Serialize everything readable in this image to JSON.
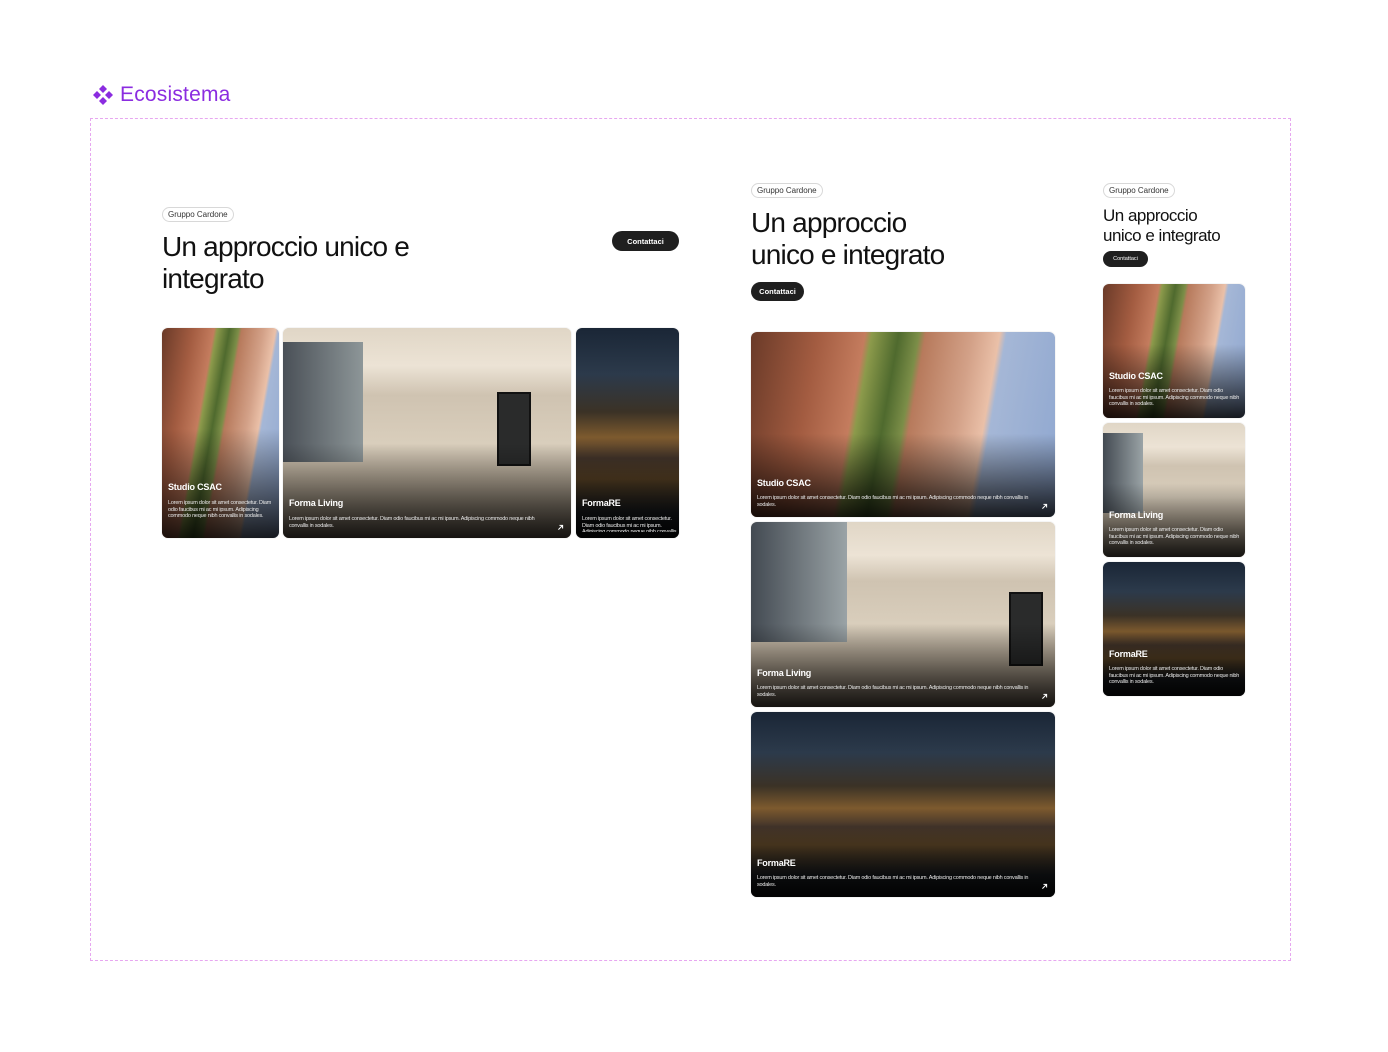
{
  "frame": {
    "title": "Ecosistema"
  },
  "variants": {
    "desktop": {
      "tag": "Gruppo Cardone",
      "heading": "Un approccio unico e integrato",
      "button": "Contattaci"
    },
    "tablet": {
      "tag": "Gruppo Cardone",
      "heading_line1": "Un approccio",
      "heading_line2": "unico e integrato",
      "button": "Contattaci"
    },
    "mobile": {
      "tag": "Gruppo Cardone",
      "heading_line1": "Un approccio",
      "heading_line2": "unico e integrato",
      "button": "Contattaci"
    }
  },
  "cards": [
    {
      "title": "Studio CSAC",
      "description": "Lorem ipsum dolor sit amet consectetur. Diam odio faucibus mi ac mi ipsum. Adipiscing commodo neque nibh convallis in sodales.",
      "image": "brick-building-vertical-garden"
    },
    {
      "title": "Forma Living",
      "description": "Lorem ipsum dolor sit amet consectetur. Diam odio faucibus mi ac mi ipsum. Adipiscing commodo neque nibh convallis in sodales.",
      "image": "bright-living-room-interior"
    },
    {
      "title": "FormaRE",
      "description": "Lorem ipsum dolor sit amet consectetur. Diam odio faucibus mi ac mi ipsum. Adipiscing commodo neque nibh convallis in sodales.",
      "image": "residential-building-at-night"
    }
  ],
  "icons": {
    "frame": "component-diamond-icon",
    "card_link": "arrow-up-right-icon"
  },
  "colors": {
    "accent": "#8b2ce0",
    "frame_border": "#e7a7f0",
    "button": "#1f1f1f"
  }
}
